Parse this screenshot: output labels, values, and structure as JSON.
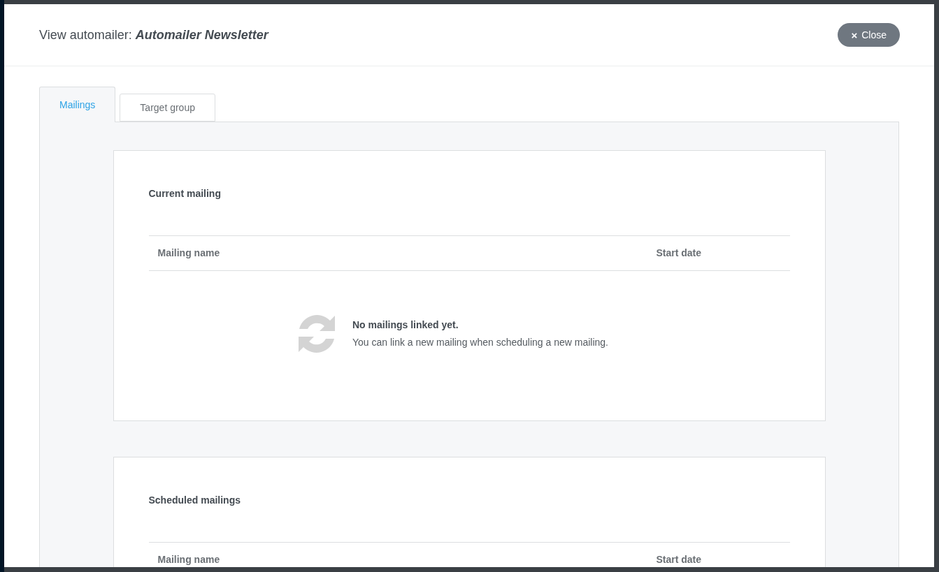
{
  "modal": {
    "title_prefix": "View automailer:",
    "title_name": "Automailer Newsletter",
    "close_button": {
      "icon": "×",
      "label": "Close"
    }
  },
  "tabs": [
    {
      "label": "Mailings",
      "selected": true
    },
    {
      "label": "Target group",
      "selected": false
    }
  ],
  "sections": [
    {
      "title": "Current mailing",
      "columns": [
        "Mailing name",
        "Start date"
      ],
      "empty_state": {
        "heading": "No mailings linked yet.",
        "message": "You can link a new mailing when scheduling a new mailing."
      }
    },
    {
      "title": "Scheduled mailings",
      "columns": [
        "Mailing name",
        "Start date"
      ]
    }
  ]
}
